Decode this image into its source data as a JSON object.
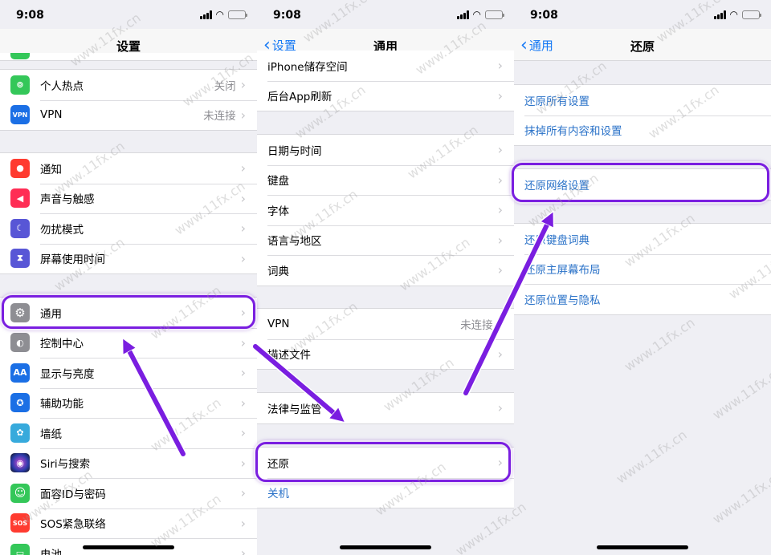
{
  "status": {
    "time": "9:08"
  },
  "panels": [
    {
      "title": "设置",
      "back": "",
      "groups": [
        {
          "rows": [
            {
              "label": "个人热点",
              "value": "关闭",
              "icon": "hotspot-icon",
              "color": "#34c759",
              "glyph": "⊚"
            },
            {
              "label": "VPN",
              "value": "未连接",
              "icon": "vpn-icon",
              "color": "#1b6fe5",
              "glyph": "VPN"
            }
          ]
        },
        {
          "rows": [
            {
              "label": "通知",
              "value": "",
              "icon": "notifications-icon",
              "color": "#ff3b30",
              "glyph": "●"
            },
            {
              "label": "声音与触感",
              "value": "",
              "icon": "sound-icon",
              "color": "#ff2d55",
              "glyph": "◀"
            },
            {
              "label": "勿扰模式",
              "value": "",
              "icon": "moon-icon",
              "color": "#5856d6",
              "glyph": "☾"
            },
            {
              "label": "屏幕使用时间",
              "value": "",
              "icon": "hourglass-icon",
              "color": "#5856d6",
              "glyph": "⧗"
            }
          ]
        },
        {
          "rows": [
            {
              "label": "通用",
              "value": "",
              "icon": "gear-icon",
              "color": "#8e8e93",
              "glyph": "⚙"
            },
            {
              "label": "控制中心",
              "value": "",
              "icon": "control-center-icon",
              "color": "#8e8e93",
              "glyph": "◐"
            },
            {
              "label": "显示与亮度",
              "value": "",
              "icon": "display-icon",
              "color": "#1b6fe5",
              "glyph": "AA"
            },
            {
              "label": "辅助功能",
              "value": "",
              "icon": "accessibility-icon",
              "color": "#1b6fe5",
              "glyph": "✪"
            },
            {
              "label": "墙纸",
              "value": "",
              "icon": "wallpaper-icon",
              "color": "#37aadc",
              "glyph": "✿"
            },
            {
              "label": "Siri与搜索",
              "value": "",
              "icon": "siri-icon",
              "color": "#222244",
              "glyph": "◉"
            },
            {
              "label": "面容ID与密码",
              "value": "",
              "icon": "faceid-icon",
              "color": "#34c759",
              "glyph": "☺"
            },
            {
              "label": "SOS紧急联络",
              "value": "",
              "icon": "sos-icon",
              "color": "#ff3b30",
              "glyph": "SOS"
            },
            {
              "label": "电池",
              "value": "",
              "icon": "battery-icon",
              "color": "#34c759",
              "glyph": "▭"
            }
          ]
        }
      ]
    },
    {
      "title": "通用",
      "back": "设置",
      "groups": [
        {
          "rows": [
            {
              "label": "iPhone储存空间",
              "value": ""
            },
            {
              "label": "后台App刷新",
              "value": ""
            }
          ]
        },
        {
          "rows": [
            {
              "label": "日期与时间",
              "value": ""
            },
            {
              "label": "键盘",
              "value": ""
            },
            {
              "label": "字体",
              "value": ""
            },
            {
              "label": "语言与地区",
              "value": ""
            },
            {
              "label": "词典",
              "value": ""
            }
          ]
        },
        {
          "rows": [
            {
              "label": "VPN",
              "value": "未连接"
            },
            {
              "label": "描述文件",
              "value": ""
            }
          ]
        },
        {
          "rows": [
            {
              "label": "法律与监管",
              "value": ""
            }
          ]
        },
        {
          "rows": [
            {
              "label": "还原",
              "value": ""
            },
            {
              "label": "关机",
              "value": ""
            }
          ]
        }
      ]
    },
    {
      "title": "还原",
      "back": "通用",
      "groups": [
        {
          "rows": [
            {
              "label": "还原所有设置"
            },
            {
              "label": "抹掉所有内容和设置"
            }
          ]
        },
        {
          "rows": [
            {
              "label": "还原网络设置"
            }
          ]
        },
        {
          "rows": [
            {
              "label": "还原键盘词典"
            },
            {
              "label": "还原主屏幕布局"
            },
            {
              "label": "还原位置与隐私"
            }
          ]
        }
      ]
    }
  ],
  "watermark_text": "www.11fx.cn",
  "colors": {
    "accent": "#1478f5",
    "link_text": "#2a72c8",
    "highlight": "#7a1ee0"
  }
}
